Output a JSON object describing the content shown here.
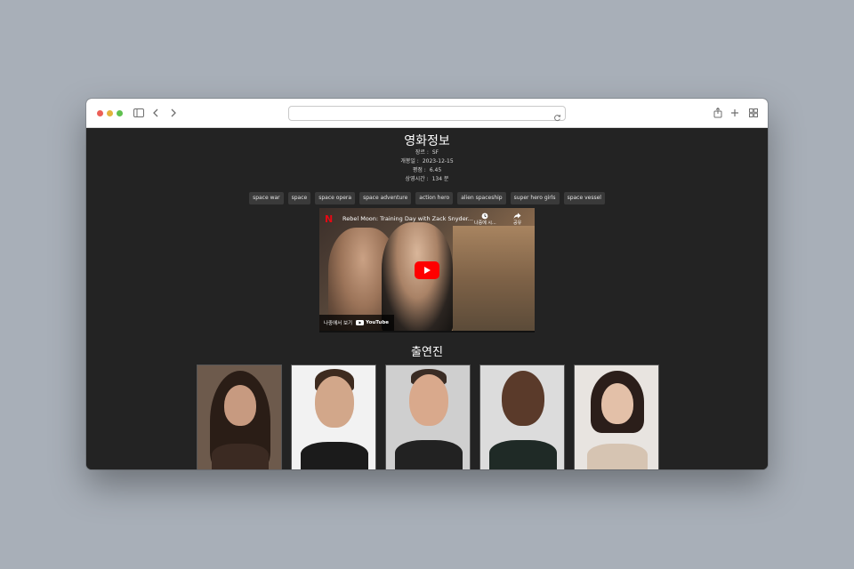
{
  "page": {
    "title": "영화정보",
    "info": [
      {
        "label": "장르 :",
        "value": "SF"
      },
      {
        "label": "개봉일 :",
        "value": "2023-12-15"
      },
      {
        "label": "평점 :",
        "value": "6.45"
      },
      {
        "label": "상영시간 :",
        "value": "134 분"
      }
    ],
    "tags": [
      "space war",
      "space",
      "space opera",
      "space adventure",
      "action hero",
      "alien spaceship",
      "super hero girls",
      "space vessel"
    ],
    "video": {
      "channel_logo": "N",
      "title": "Rebel Moon: Training Day with Zack Snyder...",
      "watch_later_label": "나중에 시...",
      "share_label": "공유",
      "watch_on_label": "나중에서 보기",
      "youtube_label": "YouTube"
    },
    "cast_title": "출연진",
    "cast": [
      {
        "icon": "actor-photo-1"
      },
      {
        "icon": "actor-photo-2"
      },
      {
        "icon": "actor-photo-3"
      },
      {
        "icon": "actor-photo-4"
      },
      {
        "icon": "actor-photo-5"
      }
    ]
  },
  "colors": {
    "desktop_bg": "#a8afb8",
    "page_bg": "#232323",
    "tag_bg": "#3a3a3a",
    "youtube_red": "#ff0000",
    "netflix_red": "#e50914"
  }
}
